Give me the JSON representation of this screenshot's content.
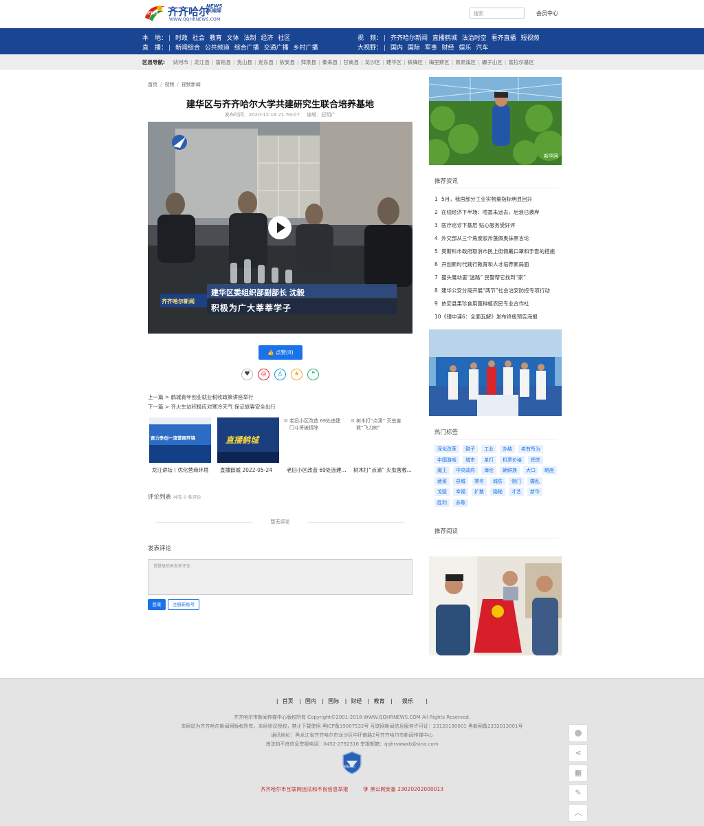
{
  "header": {
    "logo_cn": "齐齐哈尔",
    "logo_news": "NEWS\n新闻网",
    "logo_url": "WWW.QQHRNEWS.COM",
    "search_placeholder": "搜索",
    "member": "会员中心"
  },
  "nav": {
    "local_label": "本　地：",
    "local_items": [
      "时政",
      "社会",
      "教育",
      "文体",
      "法制",
      "经济",
      "社区"
    ],
    "live_label": "直　播：",
    "live_items": [
      "新闻综合",
      "公共频道",
      "综合广播",
      "交通广播",
      "乡村广播"
    ],
    "video_label": "视　频：",
    "video_items": [
      "齐齐哈尔新闻",
      "直播鹤城",
      "法治时空",
      "看齐直播",
      "短视频"
    ],
    "world_label": "大视野：",
    "world_items": [
      "国内",
      "国际",
      "军事",
      "财经",
      "娱乐",
      "汽车"
    ]
  },
  "districts": {
    "label": "区县导航:",
    "items": [
      "讷河市",
      "龙江县",
      "富裕县",
      "克山县",
      "克东县",
      "依安县",
      "拜泉县",
      "泰来县",
      "甘南县",
      "龙沙区",
      "建华区",
      "铁锋区",
      "梅里斯区",
      "昂昂溪区",
      "碾子山区",
      "富拉尔基区"
    ]
  },
  "breadcrumb": [
    "首页",
    "视频",
    "视频新闻"
  ],
  "article": {
    "title": "建华区与齐齐哈尔大学共建研究生联合培养基地",
    "publish_time": "发布时间：2020-12-18 21:59:07",
    "editor": "编辑：纪明广",
    "video_caption_1": "建华区委组织部副部长 沈毅",
    "video_caption_2": "积极为广大莘莘学子",
    "video_logo": "齐齐哈尔新闻",
    "like_label": "点赞(0)",
    "prev": "上一篇 > 鹤城青年创业就业税收政策讲座举行",
    "next": "下一篇 > 齐火车站积极应对寒冷天气 保证旅客安全出行"
  },
  "related": [
    {
      "caption": "龙江讲坛丨优化营商环境",
      "alt": "",
      "thumb_text": "奋力争创一流营商环境"
    },
    {
      "caption": "直播鹤城 2022-05-24",
      "alt": "",
      "thumb_text": "直播鹤城"
    },
    {
      "caption": "老旧小区改造 69处违建...",
      "alt": "老旧小区改造 69处违建门斗将被拆除",
      "thumb_text": ""
    },
    {
      "caption": "树木打“点滴” 灭虫害救...",
      "alt": "树木打“点滴” 灭虫害救“飞刀树”",
      "thumb_text": ""
    }
  ],
  "comments": {
    "title": "评论列表",
    "count": "共有 0 条评论",
    "empty": "暂无评论",
    "post_title": "发表评论",
    "textarea_placeholder": "请登录后再发表评论",
    "login": "登录",
    "register": "注册新账号"
  },
  "sidebar": {
    "img1_mark": "新华网",
    "recommend_title": "推荐资讯",
    "recommend": [
      "5月，我国部分工业实物量指标明显回升",
      "在线经济下半场：喧嚣未远去，后浪已袭岸",
      "医疗巡诊下基层 贴心服务受好评",
      "外交部从三个角度驳斥蓬佩奥抹黑言论",
      "莫斯科市政府取消市民上街佩戴口罩和手套的措施",
      "开创新时代践行教育和人才培养新局面",
      "猫头鹰幼崽“迷路” 民警帮它找到“家”",
      "建华公安分局开展“两节”社会治安防控专项行动",
      "依安县果珍食用菌种植农民专业合作社",
      "《镜中谍6：全面瓦解》发布终极预告海报"
    ],
    "hot_tags_title": "热门标签",
    "hot_tags": [
      [
        "深化改革",
        "鞋子",
        "工业",
        "办结",
        "老有所为"
      ],
      [
        "中国游戏",
        "城市",
        "单打",
        "机票价格",
        "把关"
      ],
      [
        "魔王",
        "中央政府",
        "海伦",
        "朝鲜族",
        "大口",
        "略座"
      ],
      [
        "蔬菜",
        "县城",
        "寒冬",
        "城防",
        "侧门",
        "霾乱"
      ],
      [
        "戈壁",
        "幸福",
        "扩散",
        "隐秘",
        "才艺",
        "新华"
      ],
      [
        "胜利",
        "苏歌"
      ]
    ],
    "read_title": "推荐阅读"
  },
  "footer": {
    "nav": [
      "首页",
      "国内",
      "国际",
      "财经",
      "教育",
      "娱乐"
    ],
    "copyright": "齐齐哈尔市新闻传媒中心版权所有 Copyright©2001-2018 WWW.QQHRNEWS.COM   All Rights Reserved.",
    "license": "本网站为齐齐哈尔新闻网版权所有，未经协议授权，禁止下载使用 黑ICP备19007532号 互联网新闻信息服务许可证：23120190001 黑新网备2332013001号",
    "address": "通讯地址：黑龙江省齐齐哈尔市龙沙区中环南路2号齐齐哈尔市新闻传媒中心",
    "report": "违法和不良信息举报电话：0452-2792316 举报邮箱：qqhrswwxb@sina.com",
    "badge": "举报单位",
    "report_link": "齐齐哈尔市互联网违法和不良信息举报",
    "police": "黑公网安备 23020202000013"
  },
  "colors": {
    "nav_bg": "#1a4593",
    "accent": "#1a73e8",
    "footer_bg": "#e4e4e4",
    "report_red": "#c03030"
  }
}
